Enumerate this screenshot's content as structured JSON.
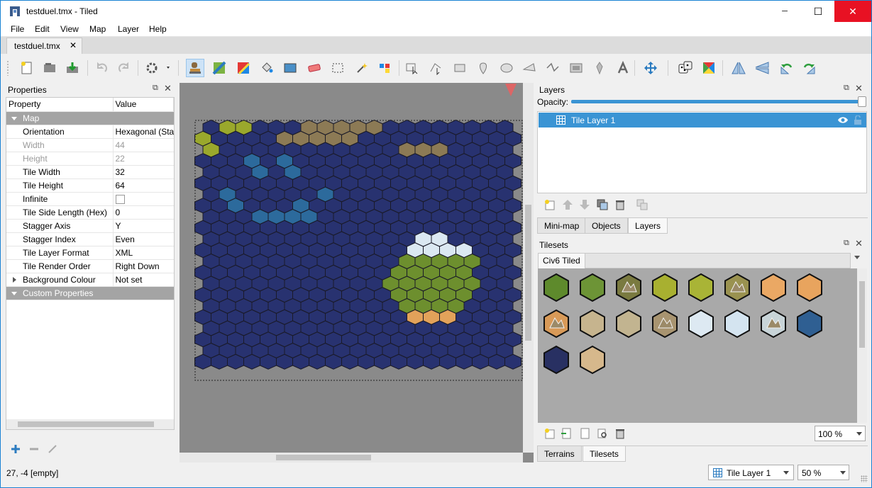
{
  "window": {
    "title": "testduel.tmx - Tiled",
    "minimize_glyph": "─",
    "maximize_glyph": "☐",
    "close_glyph": "✕"
  },
  "menu": [
    "File",
    "Edit",
    "View",
    "Map",
    "Layer",
    "Help"
  ],
  "document_tab": {
    "label": "testduel.tmx",
    "close_glyph": "✕"
  },
  "toolbar_icons": [
    "new-map-icon",
    "open-icon",
    "save-icon",
    "undo-icon",
    "redo-icon",
    "commands-icon",
    "stamp-brush-icon",
    "terrain-brush-icon",
    "wang-brush-icon",
    "bucket-fill-icon",
    "shape-fill-icon",
    "eraser-icon",
    "rectangular-select-icon",
    "magic-wand-icon",
    "select-same-tile-icon",
    "select-objects-icon",
    "edit-polygons-icon",
    "insert-rectangle-icon",
    "insert-point-icon",
    "insert-ellipse-icon",
    "insert-polygon-icon",
    "insert-polyline-icon",
    "insert-tile-icon",
    "insert-template-icon",
    "insert-text-icon",
    "move-icon",
    "random-mode-icon",
    "wang-fill-mode-icon",
    "flip-horizontal-icon",
    "flip-vertical-icon",
    "rotate-left-icon",
    "rotate-right-icon"
  ],
  "properties": {
    "title": "Properties",
    "col_property": "Property",
    "col_value": "Value",
    "group_map": "Map",
    "rows": [
      {
        "key": "Orientation",
        "value": "Hexagonal (Sta...",
        "disabled": false
      },
      {
        "key": "Width",
        "value": "44",
        "disabled": true
      },
      {
        "key": "Height",
        "value": "22",
        "disabled": true
      },
      {
        "key": "Tile Width",
        "value": "32",
        "disabled": false
      },
      {
        "key": "Tile Height",
        "value": "64",
        "disabled": false
      },
      {
        "key": "Infinite",
        "value": "",
        "disabled": false
      },
      {
        "key": "Tile Side Length (Hex)",
        "value": "0",
        "disabled": false
      },
      {
        "key": "Stagger Axis",
        "value": "Y",
        "disabled": false
      },
      {
        "key": "Stagger Index",
        "value": "Even",
        "disabled": false
      },
      {
        "key": "Tile Layer Format",
        "value": "XML",
        "disabled": false
      },
      {
        "key": "Tile Render Order",
        "value": "Right Down",
        "disabled": false
      },
      {
        "key": "Background Colour",
        "value": "Not set",
        "disabled": false
      }
    ],
    "group_custom": "Custom Properties",
    "actions": [
      "add-property-icon",
      "remove-property-icon",
      "rename-property-icon"
    ]
  },
  "layers": {
    "title": "Layers",
    "opacity_label": "Opacity:",
    "opacity": 1.0,
    "items": [
      {
        "name": "Tile Layer 1",
        "visible": true
      }
    ],
    "actions": [
      "new-layer-icon",
      "raise-layer-icon",
      "lower-layer-icon",
      "duplicate-layer-icon",
      "delete-layer-icon",
      "toggle-other-layers-icon"
    ],
    "tabs": [
      "Mini-map",
      "Objects",
      "Layers"
    ],
    "active_tab": "Layers"
  },
  "tilesets": {
    "title": "Tilesets",
    "active_tileset": "Civ6 Tiled",
    "tiles": [
      "grass",
      "grass-forest",
      "grass-mountain",
      "plains",
      "plains-forest",
      "plains-mountain",
      "desert",
      "desert-hills",
      "desert-mountain",
      "tundra-hills",
      "tundra-forest",
      "tundra-mountain",
      "snow",
      "snow-hills",
      "snow-mountain",
      "coast",
      "ocean",
      "lake-sand"
    ],
    "actions": [
      "new-tileset-icon",
      "import-tileset-icon",
      "export-tileset-icon",
      "edit-tileset-icon",
      "remove-tileset-icon"
    ],
    "zoom": "100 %",
    "tabs": [
      "Terrains",
      "Tilesets"
    ],
    "active_tab": "Tilesets"
  },
  "status": {
    "coords": "27, -4 [empty]",
    "layer_combo": "Tile Layer 1",
    "zoom": "50 %"
  },
  "colors": {
    "ocean": "#283270",
    "coast": "#2c6a9c",
    "grass": "#6d8f2e",
    "plains": "#9aa82c",
    "desert": "#e2a25a",
    "snow": "#dbe8f2",
    "mountain": "#8c7a55",
    "selection": "#3a94d4"
  }
}
